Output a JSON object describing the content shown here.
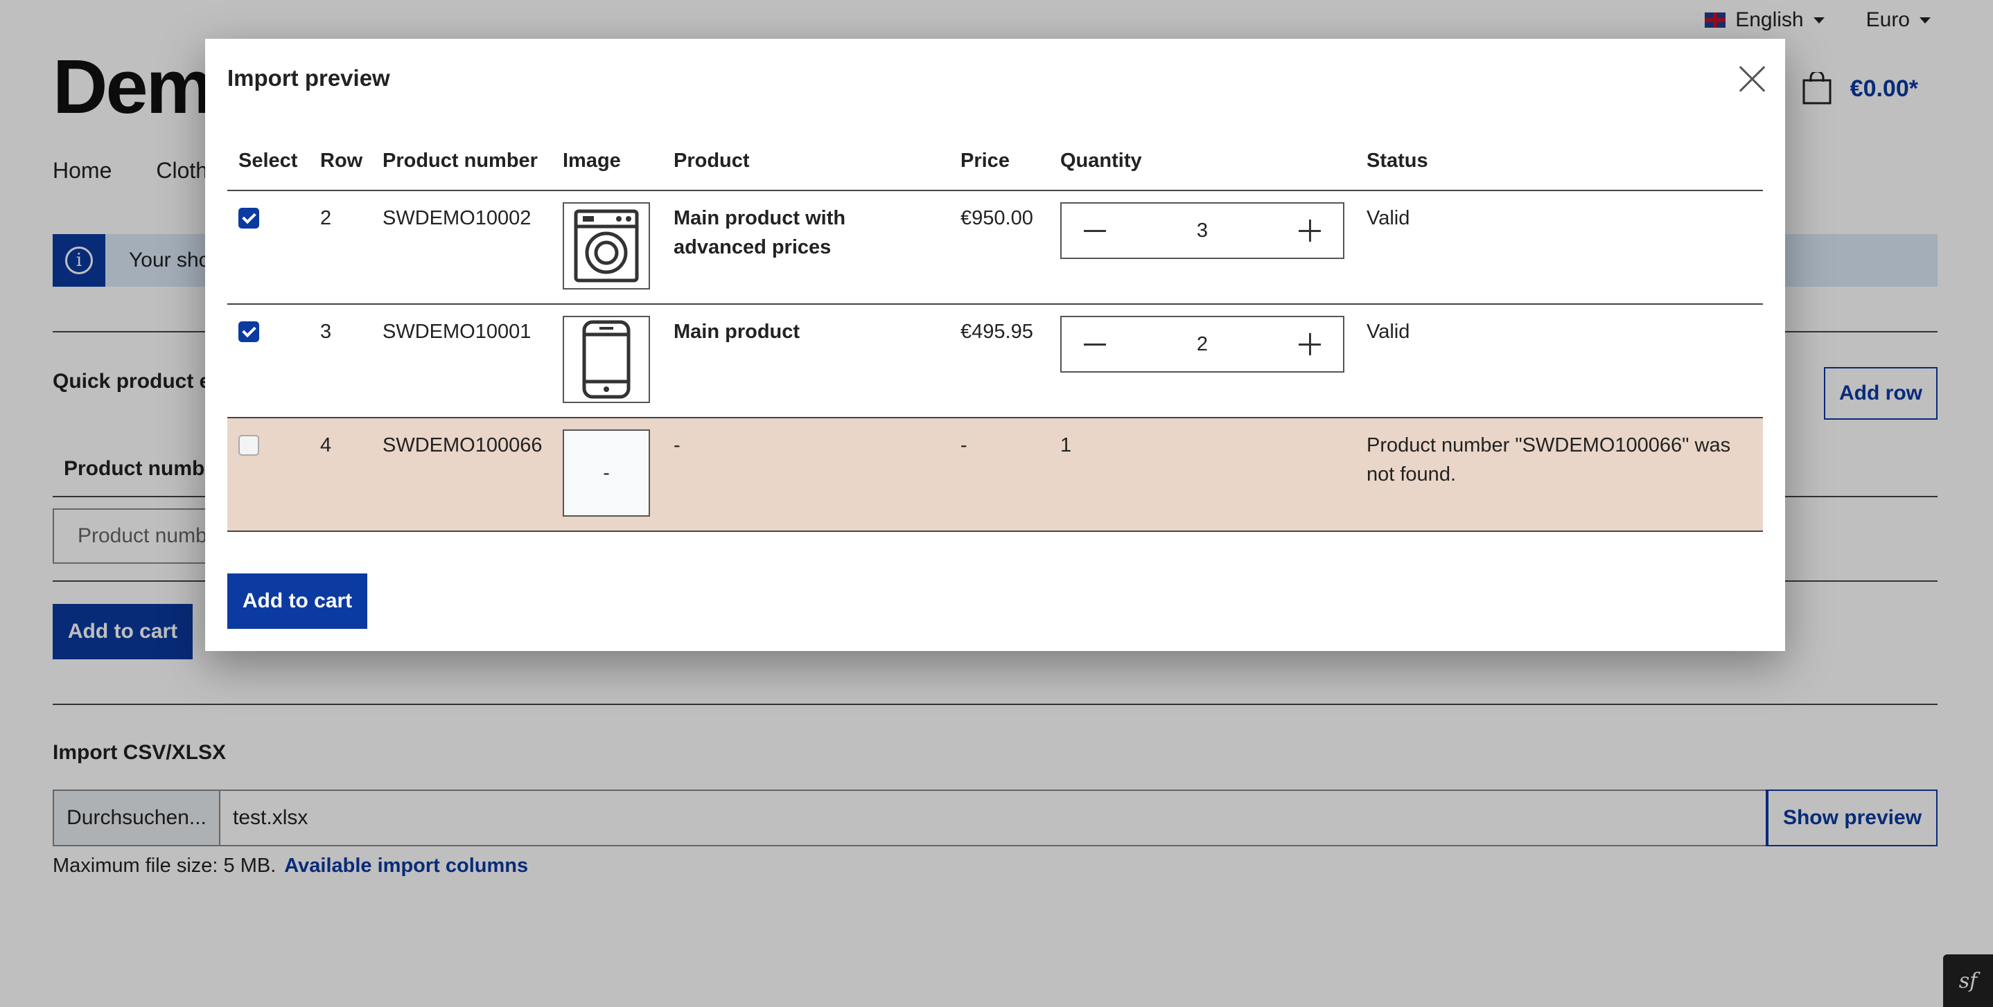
{
  "header": {
    "language": "English",
    "currency": "Euro",
    "logo": "Demo",
    "cart_total": "€0.00*"
  },
  "nav": {
    "items": [
      "Home",
      "Cloth"
    ]
  },
  "info_banner": {
    "text": "Your sho"
  },
  "quick_entry": {
    "title": "Quick product en",
    "add_row": "Add row",
    "product_number_label": "Product numbe",
    "product_number_placeholder": "Product numb",
    "add_to_cart": "Add to cart"
  },
  "import": {
    "title": "Import CSV/XLSX",
    "browse": "Durchsuchen...",
    "file_name": "test.xlsx",
    "show_preview": "Show preview",
    "max_size": "Maximum file size: 5 MB.",
    "columns_link": "Available import columns"
  },
  "modal": {
    "title": "Import preview",
    "columns": [
      "Select",
      "Row",
      "Product number",
      "Image",
      "Product",
      "Price",
      "Quantity",
      "Status"
    ],
    "rows": [
      {
        "selected": true,
        "row": "2",
        "product_number": "SWDEMO10002",
        "image": "washing-machine-icon",
        "product": "Main product with advanced prices",
        "price": "€950.00",
        "quantity": "3",
        "status": "Valid"
      },
      {
        "selected": true,
        "row": "3",
        "product_number": "SWDEMO10001",
        "image": "smartphone-icon",
        "product": "Main product",
        "price": "€495.95",
        "quantity": "2",
        "status": "Valid"
      },
      {
        "selected": false,
        "row": "4",
        "product_number": "SWDEMO100066",
        "image": "-",
        "product": "-",
        "price": "-",
        "quantity": "1",
        "status": "Product number \"SWDEMO100066\" was not found."
      }
    ],
    "add_to_cart": "Add to cart"
  },
  "colors": {
    "primary": "#0b3aa0",
    "error_row": "#e9d6c8",
    "info_bg": "#dbe9f7"
  }
}
